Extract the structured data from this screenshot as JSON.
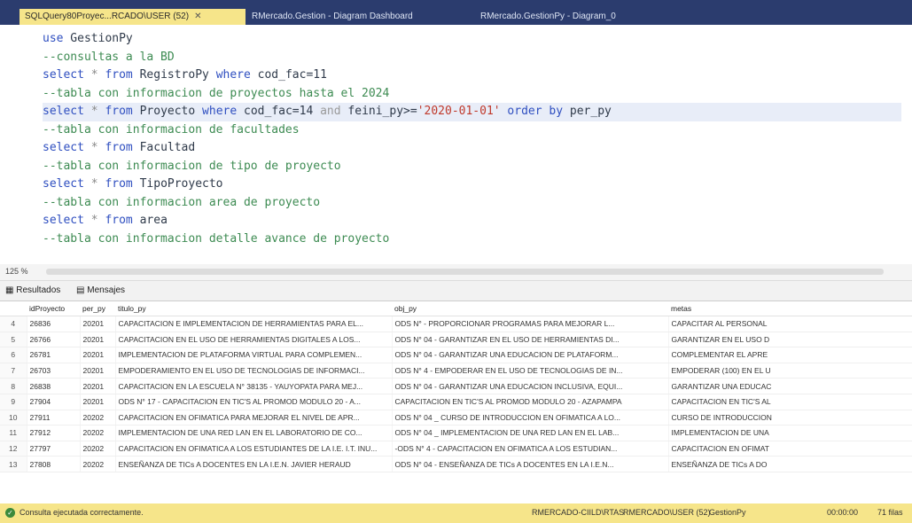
{
  "tabs": [
    {
      "label": "SQLQuery80Proyec...RCADO\\USER (52)",
      "close": "✕"
    },
    {
      "label": "RMercado.Gestion - Diagram Dashboard"
    },
    {
      "label": "RMercado.GestionPy - Diagram_0"
    }
  ],
  "editor": {
    "lines": [
      [
        {
          "t": "use",
          "c": "kw"
        },
        {
          "t": " GestionPy",
          "c": "id"
        }
      ],
      [
        {
          "t": "--consultas a la BD",
          "c": "cm"
        }
      ],
      [
        {
          "t": "select",
          "c": "kw"
        },
        {
          "t": " * ",
          "c": "op"
        },
        {
          "t": "from",
          "c": "kw"
        },
        {
          "t": " RegistroPy ",
          "c": "id"
        },
        {
          "t": "where",
          "c": "kw"
        },
        {
          "t": " cod_fac=11",
          "c": "id"
        }
      ],
      [
        {
          "t": "--tabla con informacion de proyectos hasta el 2024",
          "c": "cm"
        }
      ],
      [
        {
          "t": "select",
          "c": "kw"
        },
        {
          "t": " * ",
          "c": "op"
        },
        {
          "t": "from",
          "c": "kw"
        },
        {
          "t": " Proyecto ",
          "c": "id"
        },
        {
          "t": "where",
          "c": "kw"
        },
        {
          "t": " cod_fac=14 ",
          "c": "id"
        },
        {
          "t": "and",
          "c": "gr"
        },
        {
          "t": " feini_py>=",
          "c": "id"
        },
        {
          "t": "'2020-01-01'",
          "c": "str"
        },
        {
          "t": " order by ",
          "c": "kw"
        },
        {
          "t": "per_py",
          "c": "id"
        }
      ],
      [
        {
          "t": "--tabla con informacion de facultades",
          "c": "cm"
        }
      ],
      [
        {
          "t": "select",
          "c": "kw"
        },
        {
          "t": " * ",
          "c": "op"
        },
        {
          "t": "from",
          "c": "kw"
        },
        {
          "t": " Facultad",
          "c": "id"
        }
      ],
      [
        {
          "t": "--tabla con informacion de tipo de proyecto",
          "c": "cm"
        }
      ],
      [
        {
          "t": "select",
          "c": "kw"
        },
        {
          "t": " * ",
          "c": "op"
        },
        {
          "t": "from",
          "c": "kw"
        },
        {
          "t": " TipoProyecto",
          "c": "id"
        }
      ],
      [
        {
          "t": "--tabla con informacion area de proyecto",
          "c": "cm"
        }
      ],
      [
        {
          "t": "select",
          "c": "kw"
        },
        {
          "t": " * ",
          "c": "op"
        },
        {
          "t": "from",
          "c": "kw"
        },
        {
          "t": " area",
          "c": "id"
        }
      ],
      [
        {
          "t": "--tabla con informacion detalle avance de proyecto",
          "c": "cm"
        }
      ]
    ],
    "highlight_line": 4
  },
  "zoom": "125 %",
  "results_tabs": {
    "results": "Resultados",
    "messages": "Mensajes"
  },
  "grid": {
    "columns": [
      "",
      "idProyecto",
      "per_py",
      "titulo_py",
      "obj_py",
      "metas"
    ],
    "rows": [
      [
        "4",
        "26836",
        "20201",
        "CAPACITACION E IMPLEMENTACION DE HERRAMIENTAS PARA EL...",
        "ODS N° - PROPORCIONAR PROGRAMAS PARA MEJORAR L...",
        "CAPACITAR AL PERSONAL"
      ],
      [
        "5",
        "26766",
        "20201",
        "CAPACITACION EN EL USO DE HERRAMIENTAS DIGITALES A LOS...",
        "ODS N° 04 - GARANTIZAR EN EL USO DE HERRAMIENTAS DI...",
        "GARANTIZAR EN EL USO D"
      ],
      [
        "6",
        "26781",
        "20201",
        "IMPLEMENTACION DE PLATAFORMA VIRTUAL PARA COMPLEMEN...",
        "ODS N° 04 - GARANTIZAR UNA EDUCACION DE PLATAFORM...",
        "COMPLEMENTAR EL APRE"
      ],
      [
        "7",
        "26703",
        "20201",
        "EMPODERAMIENTO EN EL USO DE TECNOLOGIAS DE INFORMACI...",
        "ODS N° 4 - EMPODERAR EN EL USO DE TECNOLOGIAS DE IN...",
        "EMPODERAR (100) EN EL U"
      ],
      [
        "8",
        "26838",
        "20201",
        "CAPACITACION EN LA ESCUELA N° 38135 - YAUYOPATA PARA MEJ...",
        "ODS N° 04 - GARANTIZAR UNA EDUCACION INCLUSIVA, EQUI...",
        "GARANTIZAR UNA EDUCAC"
      ],
      [
        "9",
        "27904",
        "20201",
        "ODS N° 17 - CAPACITACION EN TIC'S AL PROMOD MODULO 20 - A...",
        "CAPACITACION EN TIC'S AL PROMOD MODULO 20 - AZAPAMPA",
        "CAPACITACION EN TIC'S AL"
      ],
      [
        "10",
        "27911",
        "20202",
        "CAPACITACION EN OFIMATICA PARA MEJORAR EL NIVEL DE APR...",
        "ODS N° 04 _ CURSO DE INTRODUCCION EN OFIMATICA A LO...",
        "CURSO DE INTRODUCCION"
      ],
      [
        "11",
        "27912",
        "20202",
        "IMPLEMENTACION DE UNA RED LAN EN EL LABORATORIO DE CO...",
        "ODS N° 04 _ IMPLEMENTACION DE UNA RED LAN EN EL LAB...",
        "IMPLEMENTACION DE UNA"
      ],
      [
        "12",
        "27797",
        "20202",
        "CAPACITACION EN OFIMATICA A LOS ESTUDIANTES DE LA I.E. I.T. INU...",
        "-ODS N° 4 - CAPACITACION EN OFIMATICA A LOS ESTUDIAN...",
        "CAPACITACION EN OFIMAT"
      ],
      [
        "13",
        "27808",
        "20202",
        "ENSEÑANZA DE TICs A DOCENTES EN LA I.E.N. JAVIER HERAUD",
        "ODS N° 04 - ENSEÑANZA DE TICs A DOCENTES EN LA I.E.N...",
        "ENSEÑANZA DE TICs A DO"
      ]
    ]
  },
  "status": {
    "message": "Consulta ejecutada correctamente.",
    "server": "RMERCADO-CIILD\\RTAS",
    "user": "RMERCADO\\USER (52)",
    "db": "GestionPy",
    "time": "00:00:00",
    "rows": "71 filas"
  }
}
